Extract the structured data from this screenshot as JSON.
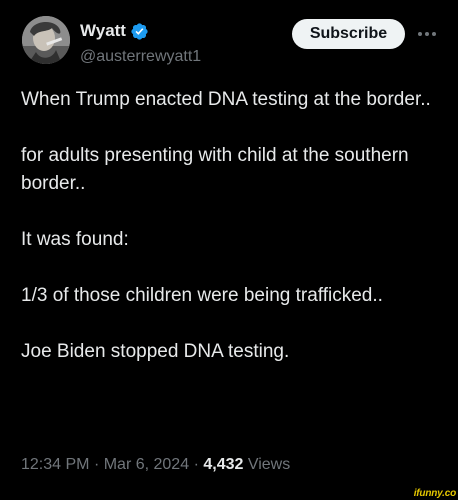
{
  "author": {
    "display_name": "Wyatt",
    "handle": "@austerrewyatt1",
    "verified": true,
    "avatar_icon": "avatar-photo"
  },
  "actions": {
    "subscribe_label": "Subscribe",
    "more_icon": "more-dots-icon"
  },
  "tweet": {
    "paragraphs": [
      "When Trump enacted DNA testing at the border..",
      "for adults presenting with child at the southern border..",
      "It was found:",
      "1/3 of those children were being trafficked..",
      "Joe Biden stopped DNA testing."
    ]
  },
  "meta": {
    "time": "12:34 PM",
    "separator": "·",
    "date": "Mar 6, 2024",
    "views_count": "4,432",
    "views_label": "Views"
  },
  "watermark": {
    "text": "ifunny.co"
  },
  "colors": {
    "background": "#000000",
    "text_primary": "#e7e9ea",
    "text_secondary": "#71767b",
    "verified_blue": "#1d9bf0",
    "button_bg": "#eff3f4",
    "watermark": "#e5c700"
  }
}
